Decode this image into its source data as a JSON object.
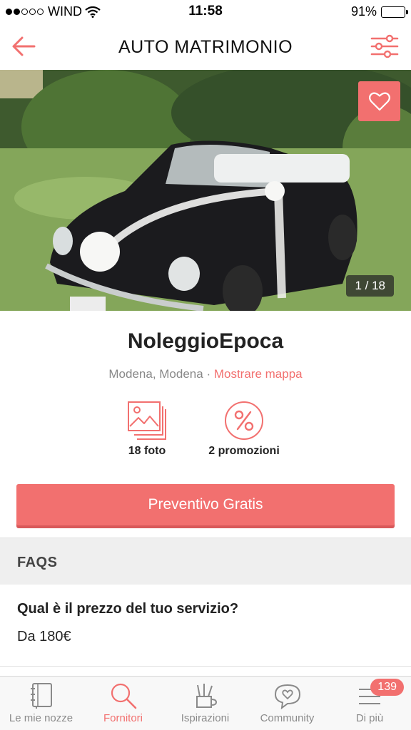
{
  "status_bar": {
    "carrier": "WIND",
    "time": "11:58",
    "battery": "91%",
    "battery_level": 0.91
  },
  "nav": {
    "title": "AUTO MATRIMONIO"
  },
  "hero": {
    "counter": "1 / 18"
  },
  "vendor": {
    "name": "NoleggioEpoca",
    "location": "Modena, Modena",
    "separator": " · ",
    "map_link": "Mostrare mappa",
    "stats": {
      "photos": "18 foto",
      "promos": "2 promozioni"
    },
    "quote_button": "Preventivo Gratis"
  },
  "faq": {
    "header": "FAQS",
    "question": "Qual è il prezzo del tuo servizio?",
    "answer": "Da 180€"
  },
  "tabs": [
    {
      "label": "Le mie nozze",
      "icon": "notebook-icon"
    },
    {
      "label": "Fornitori",
      "icon": "search-icon",
      "active": true
    },
    {
      "label": "Ispirazioni",
      "icon": "brushes-cup-icon"
    },
    {
      "label": "Community",
      "icon": "chat-heart-icon"
    },
    {
      "label": "Di più",
      "icon": "menu-lines-icon",
      "badge": "139"
    }
  ],
  "colors": {
    "accent": "#f2706f",
    "accent_dark": "#d9595a",
    "muted": "#8a8a8a"
  }
}
